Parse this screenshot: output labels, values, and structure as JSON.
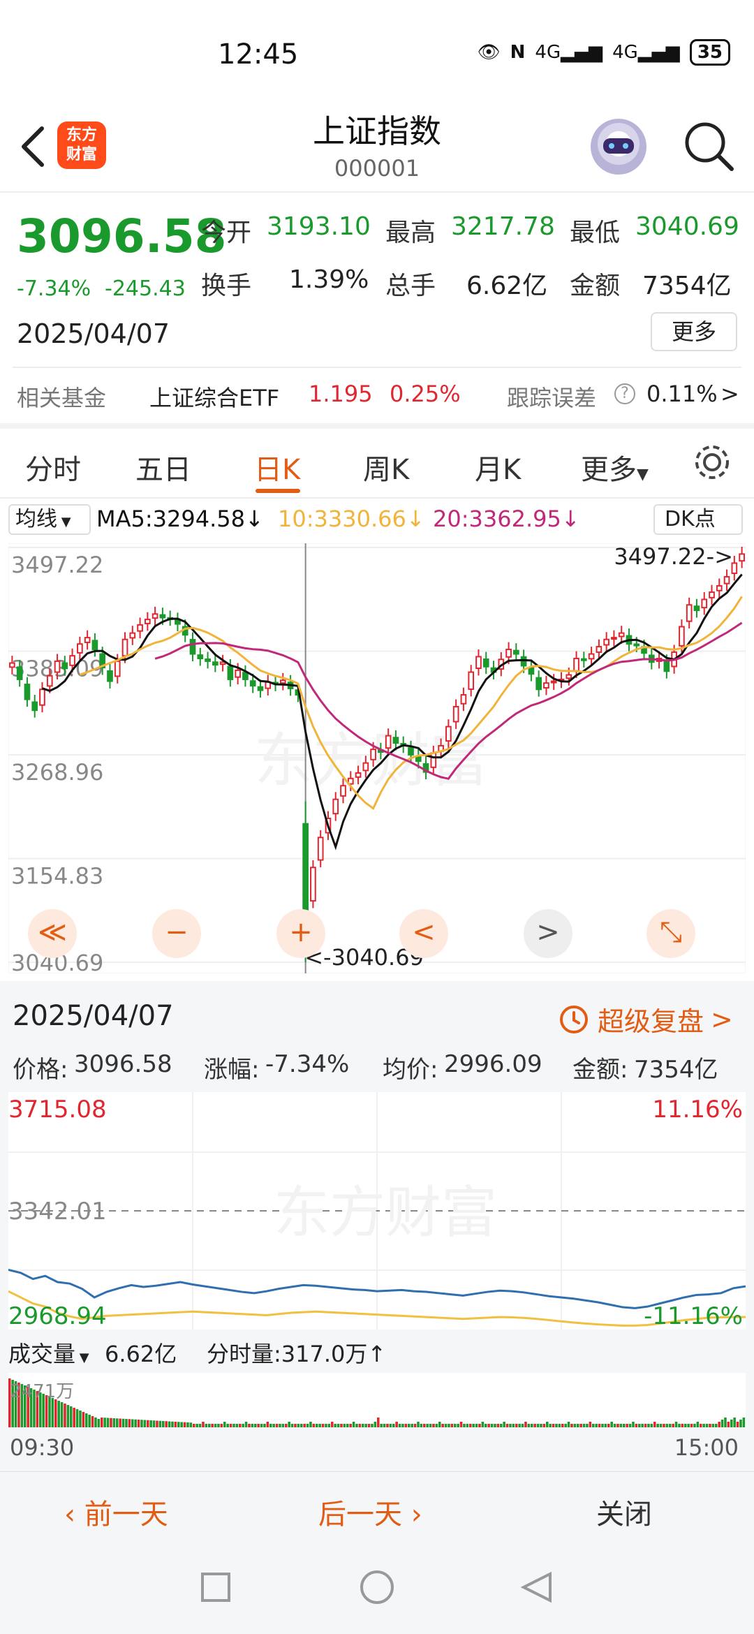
{
  "status": {
    "time": "12:45",
    "net1": "4G",
    "net2": "4G",
    "battery": "35"
  },
  "header": {
    "title": "上证指数",
    "code": "000001",
    "logo": "东方\n财富"
  },
  "quote": {
    "price": "3096.58",
    "change_pct": "-7.34%",
    "change_amt": "-245.43",
    "date": "2025/04/07",
    "open_label": "今开",
    "open": "3193.10",
    "high_label": "最高",
    "high": "3217.78",
    "low_label": "最低",
    "low": "3040.69",
    "turnover_label": "换手",
    "turnover": "1.39%",
    "volume_label": "总手",
    "volume": "6.62亿",
    "amount_label": "金额",
    "amount": "7354亿",
    "more": "更多"
  },
  "fund": {
    "label": "相关基金",
    "name": "上证综合ETF",
    "price": "1.195",
    "pct": "0.25%",
    "track_label": "跟踪误差",
    "track": "0.11%",
    "arrow": ">"
  },
  "tabs": [
    "分时",
    "五日",
    "日K",
    "周K",
    "月K",
    "更多"
  ],
  "active_tab": "日K",
  "ma": {
    "selector": "均线",
    "ma5": "MA5:3294.58↓",
    "ma10": "10:3330.66↓",
    "ma20": "20:3362.95↓",
    "dk": "DK点"
  },
  "colors": {
    "up": "#e0262f",
    "down": "#1a9a2c",
    "accent": "#e25d14",
    "ma5": "#111111",
    "ma10": "#f0b43a",
    "ma20": "#c2287a",
    "avg": "#f0c040",
    "intraday": "#2f6fb0"
  },
  "chart_data": [
    {
      "type": "candlestick",
      "title": "",
      "y_ticks": [
        "3497.22",
        "3383.09",
        "3268.96",
        "3154.83",
        "3040.69"
      ],
      "ylim": [
        3040.69,
        3497.22
      ],
      "max_label": "3497.22->",
      "min_label": "<-3040.69",
      "series_close": [
        3370,
        3352,
        3330,
        3318,
        3341,
        3356,
        3372,
        3364,
        3378,
        3391,
        3398,
        3385,
        3365,
        3350,
        3372,
        3396,
        3403,
        3412,
        3418,
        3424,
        3420,
        3419,
        3413,
        3401,
        3380,
        3375,
        3372,
        3368,
        3371,
        3352,
        3362,
        3352,
        3345,
        3340,
        3349,
        3347,
        3351,
        3342,
        3335,
        3096,
        3145,
        3178,
        3199,
        3220,
        3235,
        3243,
        3249,
        3260,
        3275,
        3272,
        3290,
        3282,
        3279,
        3269,
        3262,
        3250,
        3271,
        3279,
        3300,
        3322,
        3335,
        3360,
        3377,
        3366,
        3360,
        3374,
        3385,
        3380,
        3367,
        3358,
        3341,
        3348,
        3350,
        3352,
        3357,
        3375,
        3373,
        3380,
        3388,
        3396,
        3398,
        3403,
        3391,
        3390,
        3381,
        3371,
        3375,
        3361,
        3382,
        3410,
        3434,
        3428,
        3440,
        3448,
        3455,
        3465,
        3480,
        3490
      ],
      "ma_labels": [
        "MA5",
        "10",
        "20"
      ],
      "controls": [
        "≪",
        "−",
        "+",
        "<",
        ">",
        "⤡"
      ]
    },
    {
      "type": "line",
      "title": "",
      "y_left": [
        "3715.08",
        "3342.01",
        "2968.94"
      ],
      "y_right": [
        "11.16%",
        "-11.16%"
      ],
      "price_series": [
        3150,
        3140,
        3120,
        3130,
        3110,
        3105,
        3088,
        3060,
        3078,
        3090,
        3100,
        3094,
        3098,
        3104,
        3110,
        3102,
        3096,
        3090,
        3084,
        3078,
        3074,
        3080,
        3088,
        3094,
        3100,
        3098,
        3094,
        3090,
        3086,
        3084,
        3080,
        3082,
        3084,
        3080,
        3078,
        3074,
        3070,
        3066,
        3072,
        3078,
        3082,
        3080,
        3076,
        3070,
        3064,
        3060,
        3056,
        3050,
        3044,
        3036,
        3028,
        3025,
        3030,
        3040,
        3050,
        3060,
        3068,
        3070,
        3074,
        3090,
        3096
      ],
      "avg_series": [
        3080,
        3060,
        3040,
        3030,
        3010,
        2998,
        2990,
        2995,
        3000,
        3002,
        3004,
        3006,
        3008,
        3010,
        3012,
        3014,
        3012,
        3010,
        3008,
        3006,
        3004,
        3002,
        3006,
        3010,
        3012,
        3014,
        3012,
        3010,
        3008,
        3006,
        3004,
        3002,
        3000,
        2998,
        2996,
        2994,
        2992,
        2990,
        2992,
        2994,
        2996,
        2995,
        2993,
        2990,
        2986,
        2982,
        2978,
        2975,
        2972,
        2970,
        2968,
        2968,
        2970,
        2975,
        2980,
        2986,
        2990,
        2994,
        2995,
        2996,
        2996
      ]
    }
  ],
  "panel": {
    "date": "2025/04/07",
    "replay": "超级复盘",
    "price_label": "价格:",
    "price": "3096.58",
    "chg_label": "涨幅:",
    "chg": "-7.34%",
    "avg_label": "均价:",
    "avg": "2996.09",
    "amt_label": "金额:",
    "amt": "7354亿",
    "vol_selector": "成交量",
    "vol_total": "6.62亿",
    "vol_tick": "分时量:317.0万↑",
    "vol_max": "2471万",
    "t_start": "09:30",
    "t_end": "15:00"
  },
  "footer": {
    "prev": "前一天",
    "next": "后一天",
    "close": "关闭"
  },
  "watermark": "东方财富"
}
